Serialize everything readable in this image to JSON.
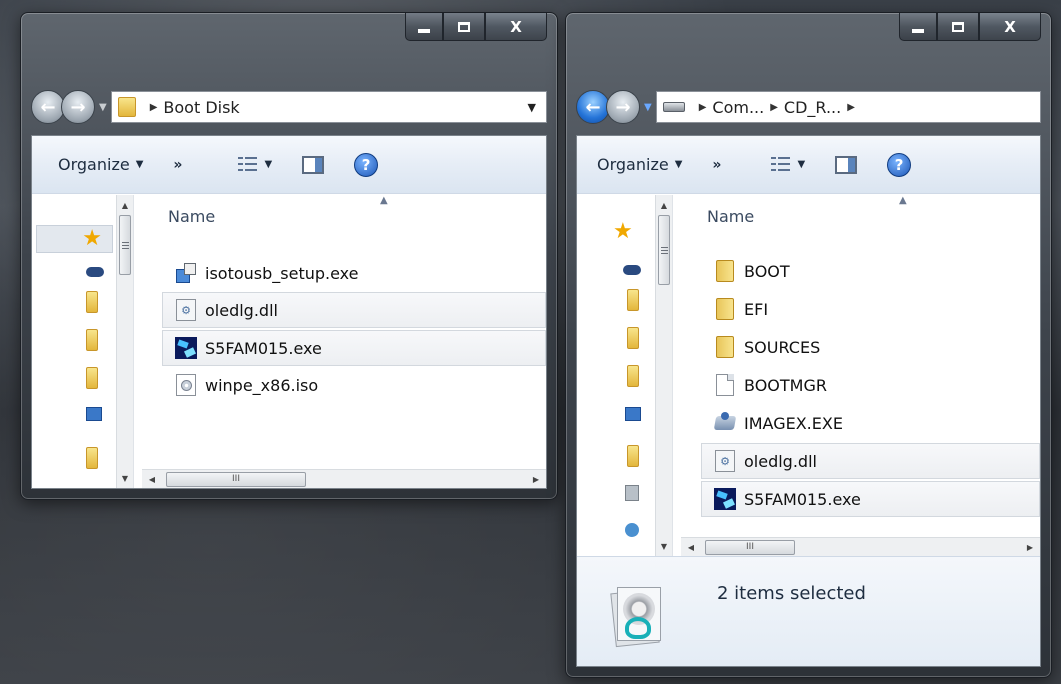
{
  "caption": {
    "minimize": "–",
    "maximize": "□",
    "close": "X"
  },
  "toolbar": {
    "organize": "Organize",
    "more": "»"
  },
  "columns": {
    "name": "Name"
  },
  "scroll": {
    "thumb_grip": "III"
  },
  "window_left": {
    "breadcrumb": [
      "Boot Disk"
    ],
    "files": [
      {
        "name": "isotousb_setup.exe",
        "icon": "installer-icon",
        "selected": false
      },
      {
        "name": "oledlg.dll",
        "icon": "dll-file-icon",
        "selected": true
      },
      {
        "name": "S5FAM015.exe",
        "icon": "application-icon",
        "selected": true
      },
      {
        "name": "winpe_x86.iso",
        "icon": "disc-image-icon",
        "selected": false
      }
    ]
  },
  "window_right": {
    "breadcrumb": [
      "Com...",
      "CD_R..."
    ],
    "files": [
      {
        "name": "BOOT",
        "icon": "folder-icon",
        "selected": false
      },
      {
        "name": "EFI",
        "icon": "folder-icon",
        "selected": false
      },
      {
        "name": "SOURCES",
        "icon": "folder-icon",
        "selected": false
      },
      {
        "name": "BOOTMGR",
        "icon": "file-icon",
        "selected": false
      },
      {
        "name": "IMAGEX.EXE",
        "icon": "imagex-app-icon",
        "selected": false
      },
      {
        "name": "oledlg.dll",
        "icon": "dll-file-icon",
        "selected": true
      },
      {
        "name": "S5FAM015.exe",
        "icon": "application-icon",
        "selected": true
      }
    ],
    "details": {
      "status": "2 items selected"
    }
  },
  "colors": {
    "accent_selection": "#edeff2",
    "toolbar_bg": "#e6edf6",
    "nav_active": "#2574d8"
  }
}
